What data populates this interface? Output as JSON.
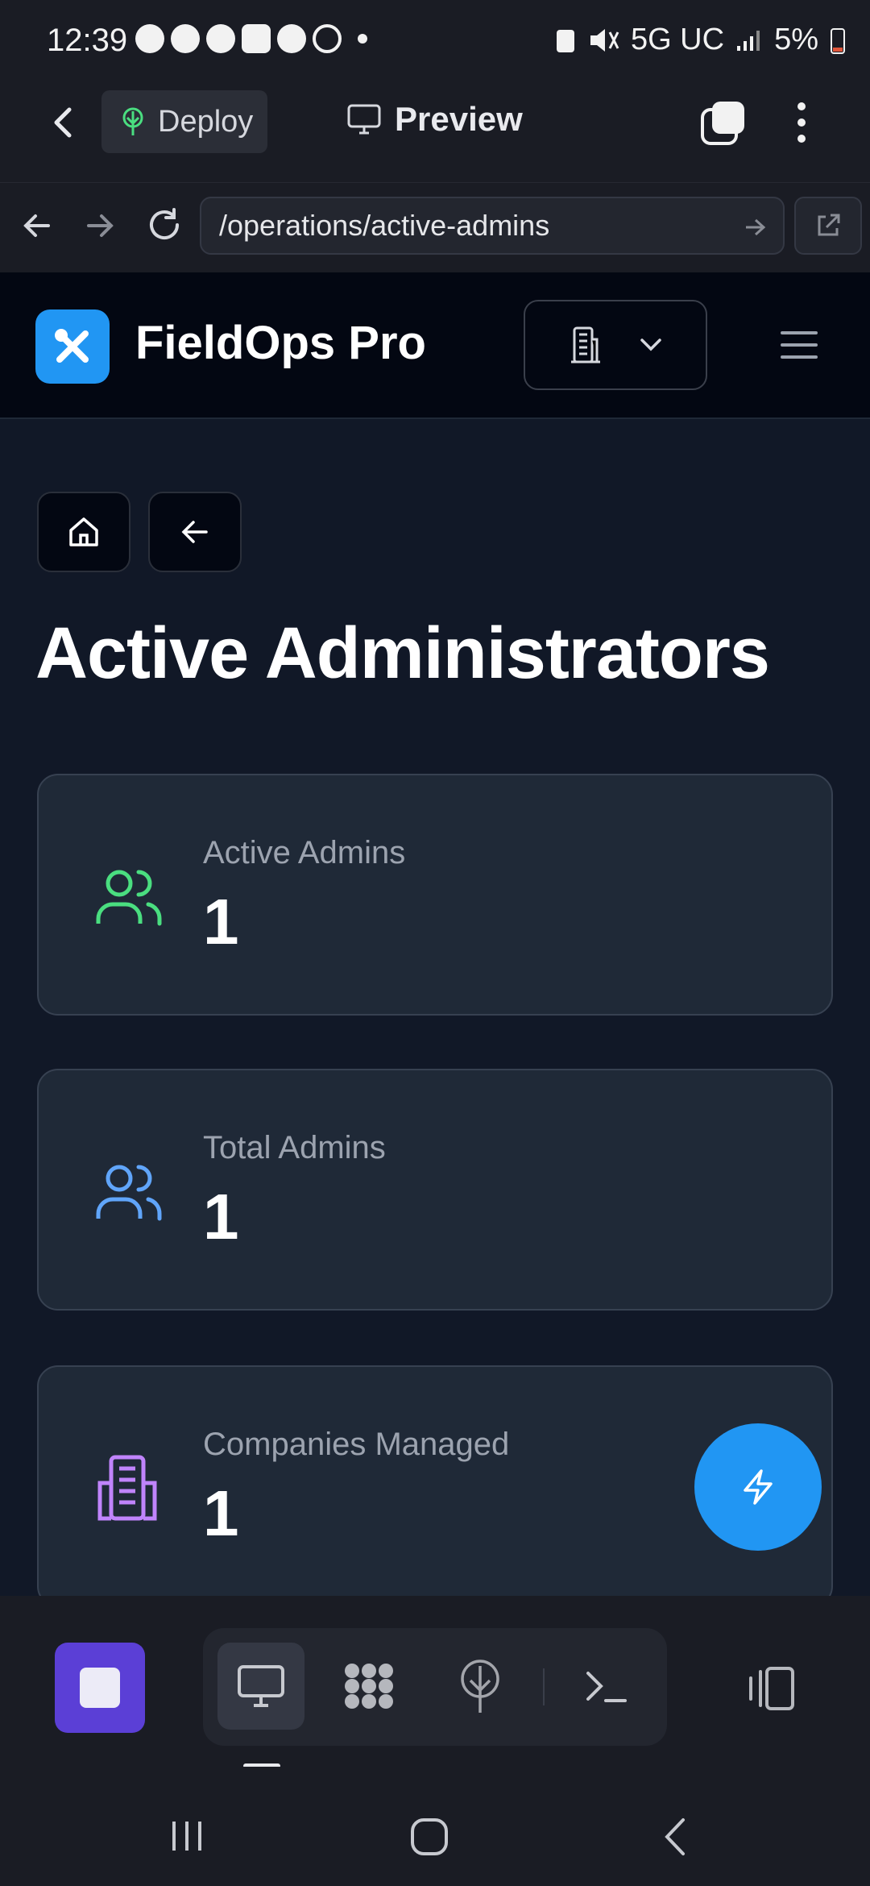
{
  "status_bar": {
    "time": "12:39",
    "network": "5G UC",
    "battery": "5%"
  },
  "app_bar": {
    "deploy_label": "Deploy",
    "preview_label": "Preview"
  },
  "url_bar": {
    "url": "/operations/active-admins"
  },
  "site": {
    "brand": "FieldOps Pro"
  },
  "page": {
    "title": "Active Administrators"
  },
  "stats": [
    {
      "label": "Active Admins",
      "value": "1",
      "icon": "users-icon",
      "color": "#4ade80"
    },
    {
      "label": "Total Admins",
      "value": "1",
      "icon": "users-icon",
      "color": "#60a5fa"
    },
    {
      "label": "Companies Managed",
      "value": "1",
      "icon": "building-icon",
      "color": "#c084fc"
    }
  ],
  "colors": {
    "accent": "#2196f3",
    "stop": "#5b3fd6"
  }
}
